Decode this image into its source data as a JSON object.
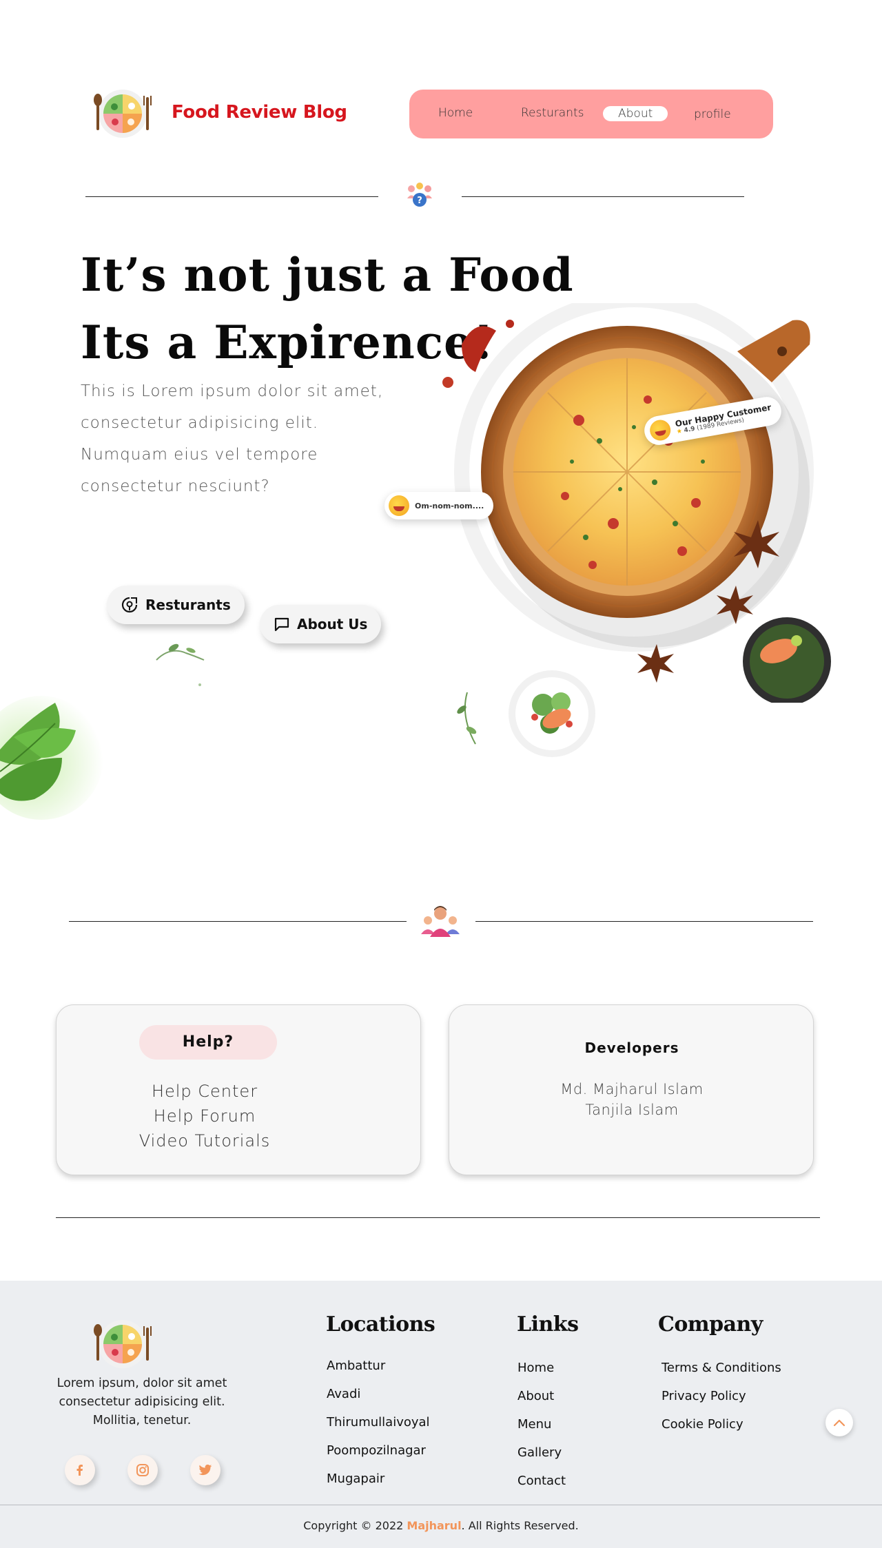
{
  "header": {
    "brand": "Food Review Blog",
    "nav": [
      {
        "label": "Home",
        "active": false
      },
      {
        "label": "Resturants",
        "active": false
      },
      {
        "label": "About",
        "active": true
      },
      {
        "label": "profile",
        "active": false
      }
    ]
  },
  "hero": {
    "title_line1": "It’s not just a Food",
    "title_line2": "Its a Expirence!",
    "text": "This is Lorem ipsum dolor sit amet, consectetur adipisicing elit. Numquam eius vel tempore consectetur nesciunt?",
    "buttons": {
      "restaurants": "Resturants",
      "about": "About Us"
    },
    "badges": {
      "happy_customer_title": "Our Happy Customer",
      "rating": "4.9",
      "reviews": "(1989 Reviews)",
      "om_nom": "Om-nom-nom...."
    }
  },
  "help_card": {
    "title": "Help?",
    "links": [
      "Help Center",
      "Help Forum",
      "Video Tutorials"
    ]
  },
  "dev_card": {
    "title": "Developers",
    "names": [
      "Md. Majharul Islam",
      "Tanjila Islam"
    ]
  },
  "footer": {
    "description": "Lorem ipsum, dolor sit amet consectetur adipisicing elit. Mollitia, tenetur.",
    "social": [
      "facebook-icon",
      "instagram-icon",
      "twitter-icon"
    ],
    "locations": {
      "title": "Locations",
      "items": [
        "Ambattur",
        "Avadi",
        "Thirumullaivoyal",
        "Poompozilnagar",
        "Mugapair"
      ]
    },
    "links": {
      "title": "Links",
      "items": [
        "Home",
        "About",
        "Menu",
        "Gallery",
        "Contact"
      ]
    },
    "company": {
      "title": "Company",
      "items": [
        "Terms & Conditions",
        "Privacy Policy",
        "Cookie Policy"
      ]
    },
    "copyright_prefix": "Copyright © 2022 ",
    "copyright_name": "Majharul",
    "copyright_suffix": ". All Rights Reserved."
  },
  "colors": {
    "brand_red": "#d6161e",
    "nav_bg": "#ff9f9f",
    "help_title_bg": "#f9e3e4",
    "accent_orange": "#f2955a",
    "footer_bg": "#eceef1"
  }
}
